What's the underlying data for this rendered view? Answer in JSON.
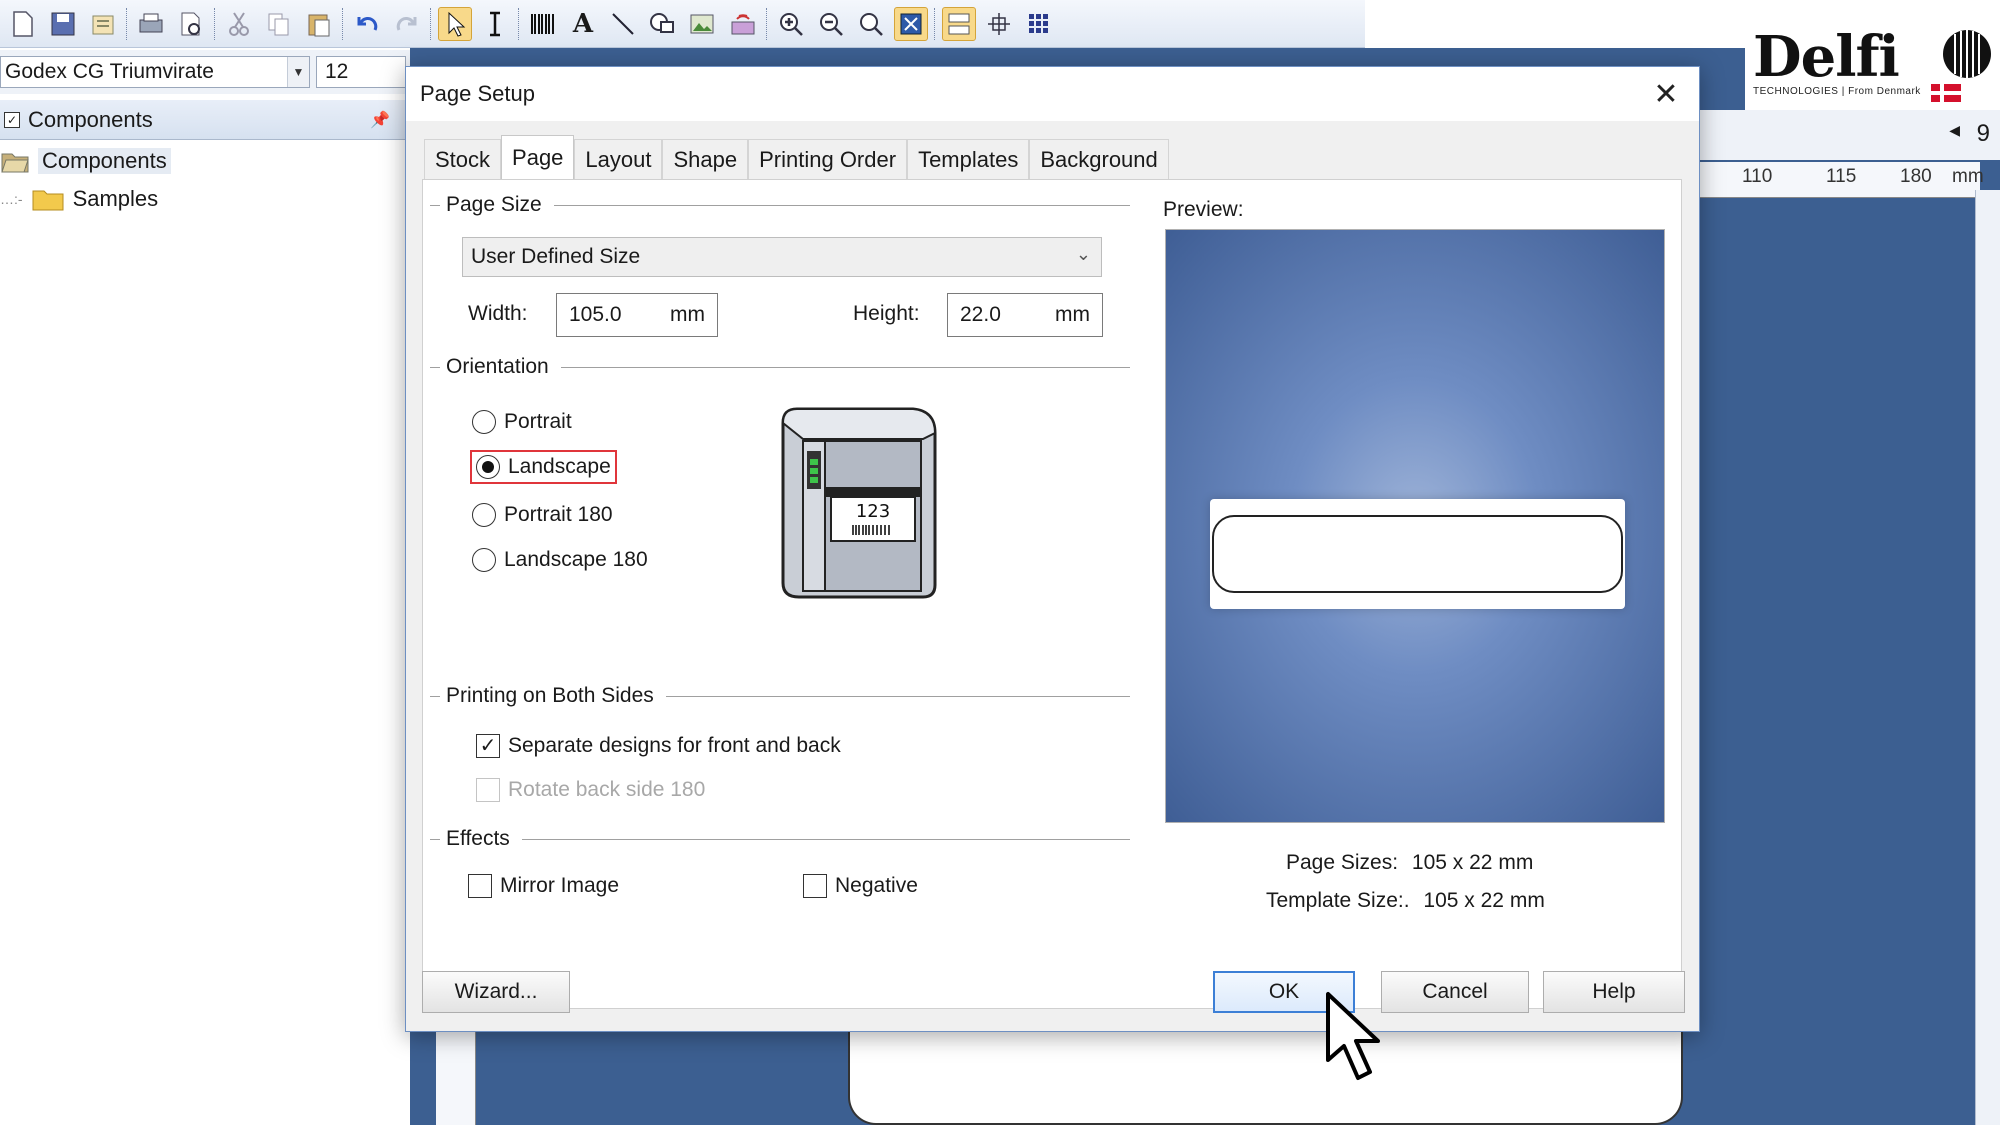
{
  "app": {
    "font_name": "Godex CG Triumvirate",
    "font_size": "12",
    "panel_title": "Components",
    "tree": [
      "Components",
      "Samples"
    ],
    "ruler_ticks": [
      "110",
      "115",
      "180",
      "mm"
    ],
    "right_number": "9"
  },
  "logo": {
    "word": "Delfi",
    "tagline": "TECHNOLOGIES | From Denmark"
  },
  "dialog": {
    "title": "Page Setup",
    "tabs": [
      "Stock",
      "Page",
      "Layout",
      "Shape",
      "Printing Order",
      "Templates",
      "Background"
    ],
    "active_tab": "Page",
    "page_size": {
      "group_label": "Page Size",
      "selected": "User Defined Size",
      "width_label": "Width:",
      "width_value": "105.0",
      "height_label": "Height:",
      "height_value": "22.0",
      "unit": "mm"
    },
    "orientation": {
      "group_label": "Orientation",
      "options": [
        "Portrait",
        "Landscape",
        "Portrait 180",
        "Landscape 180"
      ],
      "selected": "Landscape",
      "printer_display": "123"
    },
    "both_sides": {
      "group_label": "Printing on Both Sides",
      "separate_label": "Separate designs for front and back",
      "separate_checked": true,
      "rotate_label": "Rotate back side 180",
      "rotate_checked": false,
      "rotate_enabled": false
    },
    "effects": {
      "group_label": "Effects",
      "mirror_label": "Mirror Image",
      "mirror_checked": false,
      "negative_label": "Negative",
      "negative_checked": false
    },
    "preview": {
      "label": "Preview:",
      "page_sizes_label": "Page Sizes:",
      "page_sizes_value": "105 x 22 mm",
      "template_size_label": "Template Size:.",
      "template_size_value": "105 x 22 mm"
    },
    "buttons": {
      "wizard": "Wizard...",
      "ok": "OK",
      "cancel": "Cancel",
      "help": "Help"
    },
    "close_symbol": "✕"
  },
  "colors": {
    "canvas_blue": "#3c5f91",
    "focus_red": "#e0353b",
    "default_blue": "#3c7fd6"
  }
}
